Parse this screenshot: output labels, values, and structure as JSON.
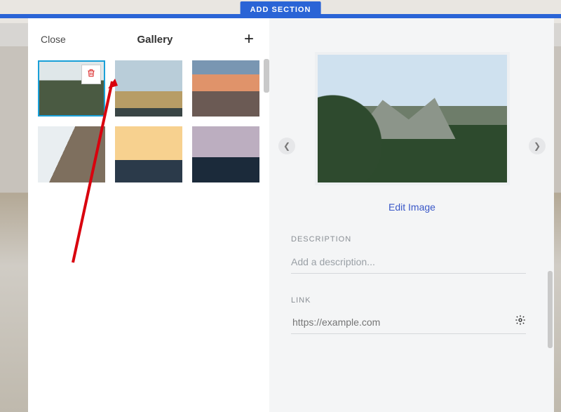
{
  "topbar": {
    "add_section": "ADD SECTION"
  },
  "left": {
    "close": "Close",
    "title": "Gallery",
    "thumbs": [
      "img-1",
      "img-2",
      "img-3",
      "img-4",
      "img-5",
      "img-6"
    ]
  },
  "right": {
    "edit_image": "Edit Image",
    "description_label": "DESCRIPTION",
    "description_placeholder": "Add a description...",
    "link_label": "LINK",
    "link_placeholder": "https://example.com"
  }
}
